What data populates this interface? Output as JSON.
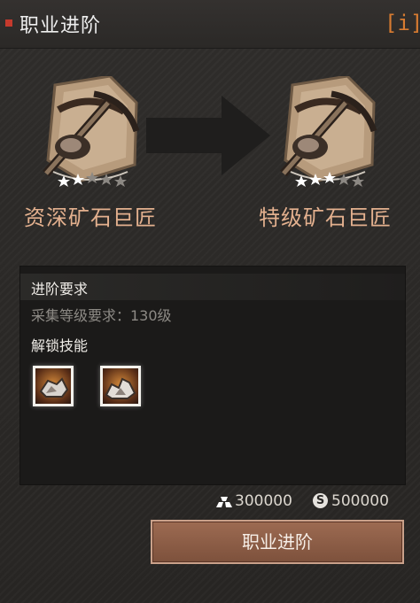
{
  "header": {
    "title": "职业进阶",
    "info_icon": "info-icon"
  },
  "ranks": {
    "current": {
      "name": "资深矿石巨匠",
      "stars": 5,
      "filled_stars": 2
    },
    "next": {
      "name": "特级矿石巨匠",
      "stars": 5,
      "filled_stars": 3
    }
  },
  "requirements": {
    "title": "进阶要求",
    "line": "采集等级要求：130级",
    "skills_title": "解锁技能",
    "skills": [
      "ore-skill-icon",
      "ore-skill-icon-2"
    ]
  },
  "costs": {
    "gold": "300000",
    "silver_symbol": "S",
    "silver": "500000"
  },
  "advance_button": {
    "label": "职业进阶"
  },
  "colors": {
    "accent": "#e58a3a",
    "rank_text": "#e3b08e",
    "button": "#8f5f48"
  }
}
